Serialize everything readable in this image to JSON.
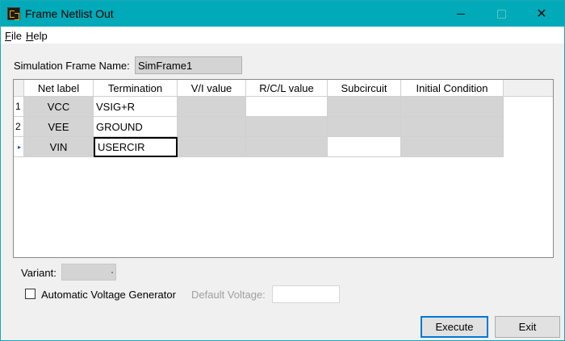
{
  "window": {
    "title": "Frame Netlist Out",
    "app_icon": "netlist-app-icon",
    "close_glyph": "✕"
  },
  "menu": {
    "file": "File",
    "file_mnemonic": "F",
    "file_rest": "ile",
    "help": "Help",
    "help_mnemonic": "H",
    "help_rest": "elp"
  },
  "frame": {
    "label": "Simulation Frame Name:",
    "value": "SimFrame1"
  },
  "grid": {
    "columns": [
      "Net label",
      "Termination",
      "V/I value",
      "R/C/L value",
      "Subcircuit",
      "Initial Condition"
    ],
    "rows": [
      {
        "index": "1",
        "net_label": "VCC",
        "termination": "VSIG+R"
      },
      {
        "index": "2",
        "net_label": "VEE",
        "termination": "GROUND"
      },
      {
        "index": "▸",
        "net_label": "VIN",
        "termination": "USERCIR"
      }
    ]
  },
  "variant": {
    "label": "Variant:",
    "value": ""
  },
  "auto_voltage": {
    "label": "Automatic Voltage Generator",
    "checked": false
  },
  "default_voltage": {
    "label": "Default Voltage:",
    "value": ""
  },
  "buttons": {
    "execute": "Execute",
    "exit": "Exit"
  },
  "colors": {
    "titlebar": "#00aab8",
    "disabled_cell": "#d4d4d4",
    "focus_border": "#0078d7"
  }
}
